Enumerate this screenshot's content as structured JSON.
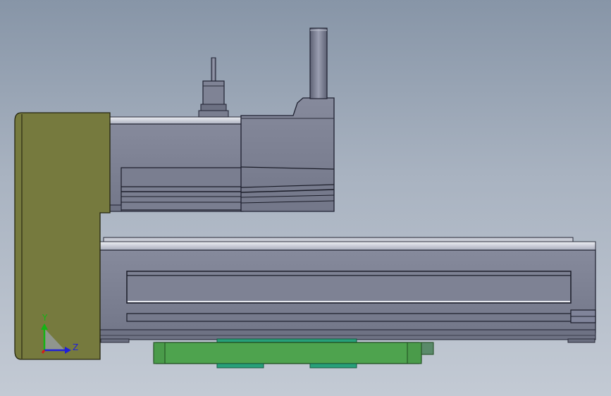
{
  "app": {
    "view": "cad-model-viewport"
  },
  "triad": {
    "y_label": "Y",
    "z_label": "Z",
    "y_color": "#14b414",
    "z_color": "#2020d8",
    "x_color": "#d81818"
  },
  "colors": {
    "background_top": "#8795a7",
    "background_bottom": "#c3cad4",
    "bracket": "#767a3e",
    "actuator_body": "#7d8193",
    "actuator_edge": "#1e2030",
    "carriage": "#4ea34e",
    "carriage_strip": "#27a07a"
  }
}
